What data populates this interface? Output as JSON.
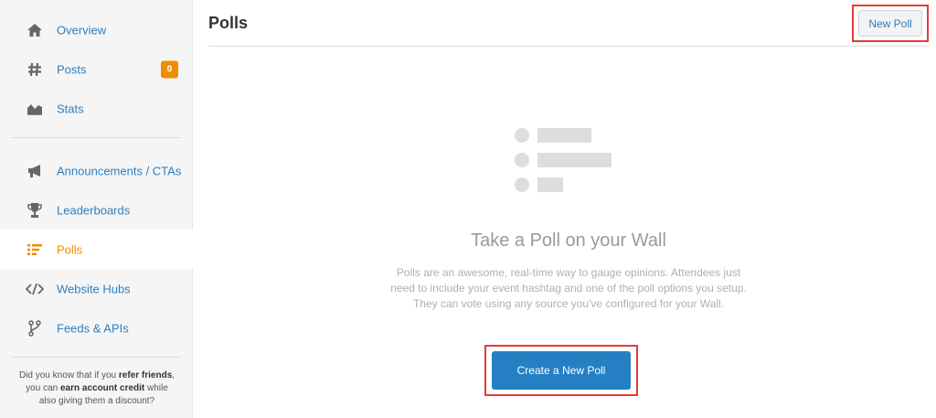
{
  "sidebar": {
    "items": [
      {
        "label": "Overview",
        "icon": "home-icon"
      },
      {
        "label": "Posts",
        "icon": "hashtag-icon",
        "badge": "0"
      },
      {
        "label": "Stats",
        "icon": "chart-icon"
      },
      {
        "label": "Announcements / CTAs",
        "icon": "megaphone-icon"
      },
      {
        "label": "Leaderboards",
        "icon": "trophy-icon"
      },
      {
        "label": "Polls",
        "icon": "poll-icon",
        "active": true
      },
      {
        "label": "Website Hubs",
        "icon": "code-icon"
      },
      {
        "label": "Feeds & APIs",
        "icon": "branch-icon"
      }
    ],
    "promo": {
      "pre": "Did you know that if you ",
      "bold1": "refer friends",
      "mid": ", you can ",
      "bold2": "earn account credit",
      "post": " while also giving them a discount?"
    }
  },
  "header": {
    "title": "Polls",
    "new_poll_label": "New Poll"
  },
  "empty_state": {
    "title": "Take a Poll on your Wall",
    "description": "Polls are an awesome, real-time way to gauge opinions. Attendees just need to include your event hashtag and one of the poll options you setup. They can vote using any source you've configured for your Wall.",
    "button_label": "Create a New Poll"
  },
  "colors": {
    "accent": "#f08c00",
    "link": "#2d7fbf",
    "primary_button": "#2580c3",
    "highlight_box": "#e53a3a"
  }
}
